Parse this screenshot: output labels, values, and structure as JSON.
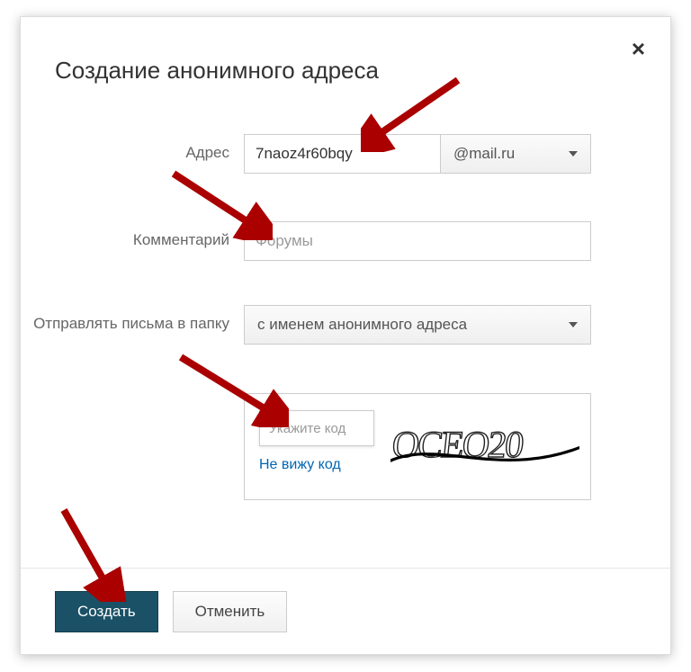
{
  "modal": {
    "title": "Создание анонимного адреса",
    "close_symbol": "×"
  },
  "form": {
    "address": {
      "label": "Адрес",
      "value": "7naoz4r60bqy",
      "domain": "@mail.ru"
    },
    "comment": {
      "label": "Комментарий",
      "placeholder": "Форумы"
    },
    "folder": {
      "label": "Отправлять письма в папку",
      "value": "с именем анонимного адреса"
    },
    "captcha": {
      "placeholder": "Укажите код",
      "link": "Не вижу код",
      "image_text": "OCEO20"
    }
  },
  "footer": {
    "create": "Создать",
    "cancel": "Отменить"
  }
}
